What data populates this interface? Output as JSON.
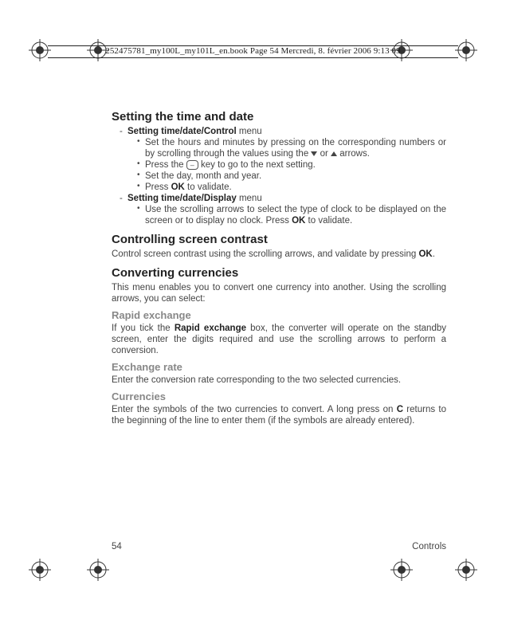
{
  "header": "252475781_my100L_my101L_en.book  Page 54  Mercredi, 8. février 2006  9:13 09",
  "h1": "Setting the time and date",
  "menu1_title": "Setting time/date/Control",
  "menu1_word": " menu",
  "m1": {
    "b1a": "Set the hours and minutes by pressing on the corresponding numbers or by scrolling through the values using the ",
    "b1b": " or ",
    "b1c": " arrows.",
    "b2a": "Press the ",
    "b2b": " key to go to the next setting.",
    "b3": "Set the day, month and year.",
    "b4a": "Press ",
    "b4b": "OK",
    "b4c": " to validate."
  },
  "menu2_title": "Setting time/date/Display",
  "menu2_word": " menu",
  "m2": {
    "b1a": "Use the scrolling arrows to select the type of clock to be displayed on the screen or to display no clock. Press ",
    "b1b": "OK",
    "b1c": " to validate."
  },
  "h2": "Controlling screen contrast",
  "p2a": "Control screen contrast using the scrolling arrows, and validate by pressing ",
  "p2b": "OK",
  "p2c": ".",
  "h3": "Converting currencies",
  "p3": "This menu enables you to convert one currency into another. Using the scrolling arrows, you can select:",
  "s1": "Rapid exchange",
  "p4a": "If you tick the ",
  "p4b": "Rapid exchange",
  "p4c": " box, the converter will operate on the standby screen, enter the digits required and use the scrolling arrows to perform a conversion.",
  "s2": "Exchange rate",
  "p5": "Enter the conversion rate corresponding to the two selected currencies.",
  "s3": "Currencies",
  "p6a": "Enter the symbols of the two currencies to convert. A long press on ",
  "p6b": "C",
  "p6c": " returns to the beginning of the line to enter them (if the symbols are already entered).",
  "footer_page": "54",
  "footer_section": "Controls",
  "key_glyph": "–"
}
